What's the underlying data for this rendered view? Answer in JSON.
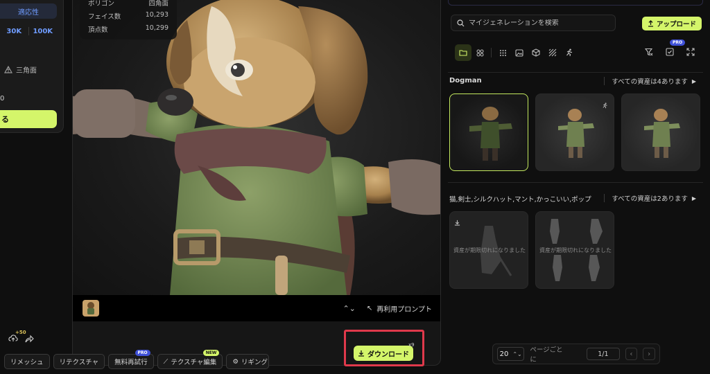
{
  "left_panel": {
    "fit_label": "適応性",
    "res_options": [
      "30K",
      "100K"
    ],
    "triangle_label": "三角面",
    "count_value": "0",
    "cta_fragment": "る"
  },
  "viewer": {
    "stats": [
      {
        "label": "ポリゴン",
        "value": "四角面"
      },
      {
        "label": "フェイス数",
        "value": "10,293"
      },
      {
        "label": "頂点数",
        "value": "10,299"
      }
    ],
    "reuse_prompt": "再利用プロンプト",
    "credit_badge": "+50",
    "buttons": {
      "remesh": "リメッシュ",
      "retexture": "リテクスチャ",
      "free_retry": "無料再試行",
      "texture_edit": "テクスチャ編集",
      "rigging": "リギング",
      "download": "ダウンロード",
      "download_count": "x9",
      "pro_tag": "PRO",
      "new_tag": "NEW"
    }
  },
  "right_panel": {
    "search_placeholder": "マイジェネレーションを検索",
    "upload_label": "アップロード",
    "filter_pro_tag": "PRO",
    "section1": {
      "title": "Dogman",
      "link": "すべての資産は4あります"
    },
    "section2": {
      "title": "猫,剣士,シルクハット,マント,かっこいい,ポップ",
      "link": "すべての資産は2あります"
    },
    "expired_text": "資産が期限切れになりました",
    "pager": {
      "page_size": "20",
      "per_page_label": "ページごとに",
      "page_indicator": "1/1"
    }
  },
  "colors": {
    "accent": "#d4f56a",
    "pro": "#3f51d8",
    "highlight": "#e0394b"
  }
}
